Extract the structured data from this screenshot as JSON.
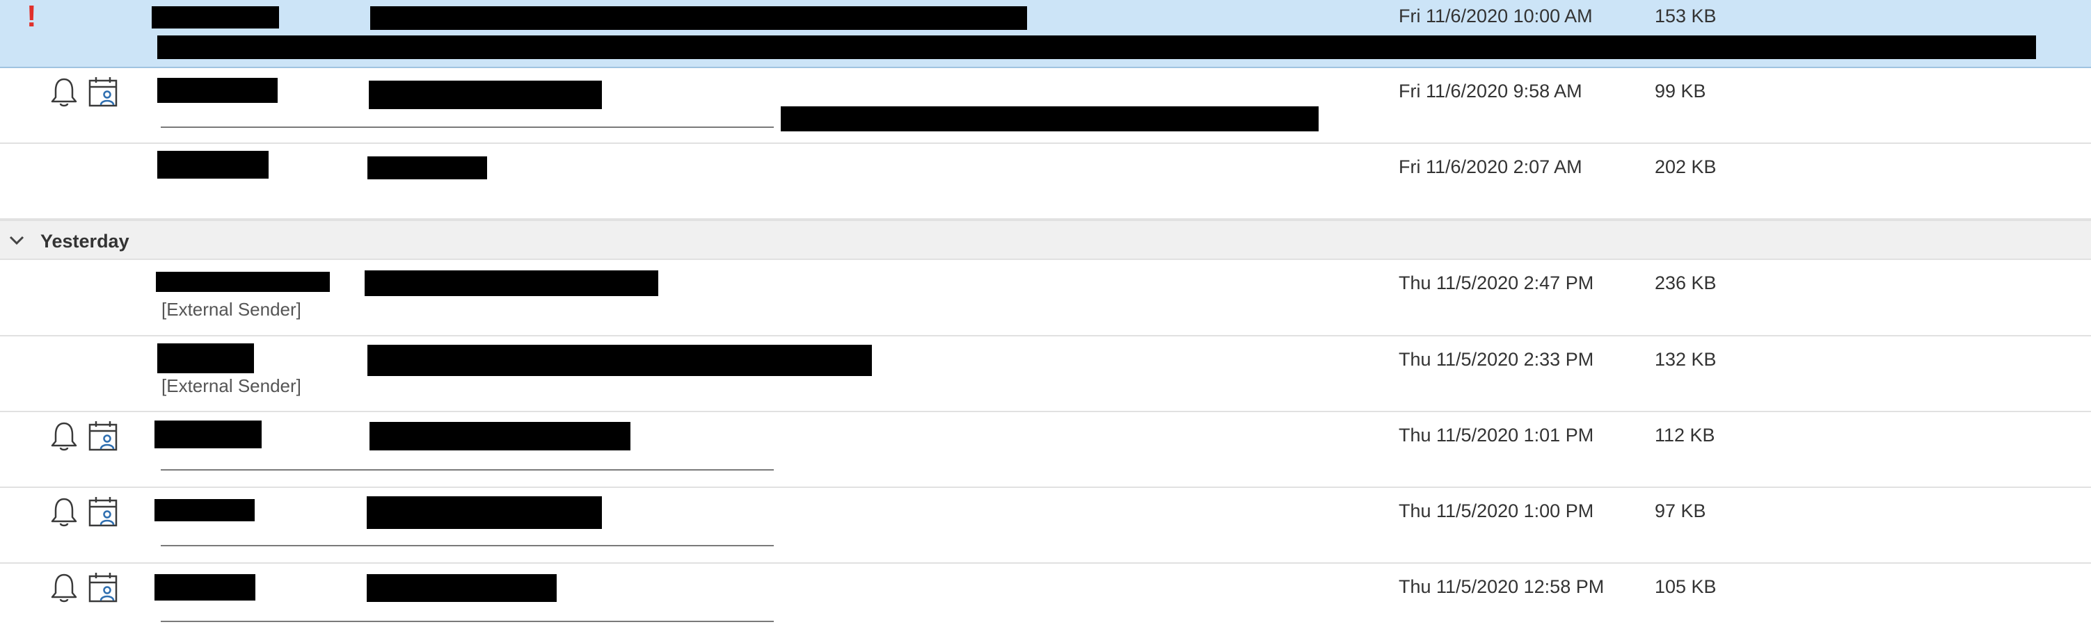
{
  "colors": {
    "selected_background": "#cce4f7",
    "group_header_background": "#f0f0f0",
    "importance_red": "#e0302b",
    "redaction": "#000000",
    "icon_accent_blue": "#2f6fb0"
  },
  "importance_icon": "!",
  "rows_before_group": [
    {
      "received": "Fri 11/6/2020 10:00 AM",
      "size": "153 KB",
      "selected": true,
      "high_importance": true
    },
    {
      "received": "Fri 11/6/2020 9:58 AM",
      "size": "99 KB",
      "icons": [
        "reminder-bell-icon",
        "meeting-calendar-icon"
      ]
    },
    {
      "received": "Fri 11/6/2020 2:07 AM",
      "size": "202 KB"
    }
  ],
  "group": {
    "label": "Yesterday",
    "icon": "chevron-down-icon"
  },
  "rows_after_group": [
    {
      "received": "Thu 11/5/2020 2:47 PM",
      "size": "236 KB",
      "tag": "[External Sender]"
    },
    {
      "received": "Thu 11/5/2020 2:33 PM",
      "size": "132 KB",
      "tag": "[External Sender]"
    },
    {
      "received": "Thu 11/5/2020 1:01 PM",
      "size": "112 KB",
      "icons": [
        "reminder-bell-icon",
        "meeting-calendar-icon"
      ]
    },
    {
      "received": "Thu 11/5/2020 1:00 PM",
      "size": "97 KB",
      "icons": [
        "reminder-bell-icon",
        "meeting-calendar-icon"
      ]
    },
    {
      "received": "Thu 11/5/2020 12:58 PM",
      "size": "105 KB",
      "icons": [
        "reminder-bell-icon",
        "meeting-calendar-icon"
      ]
    }
  ]
}
